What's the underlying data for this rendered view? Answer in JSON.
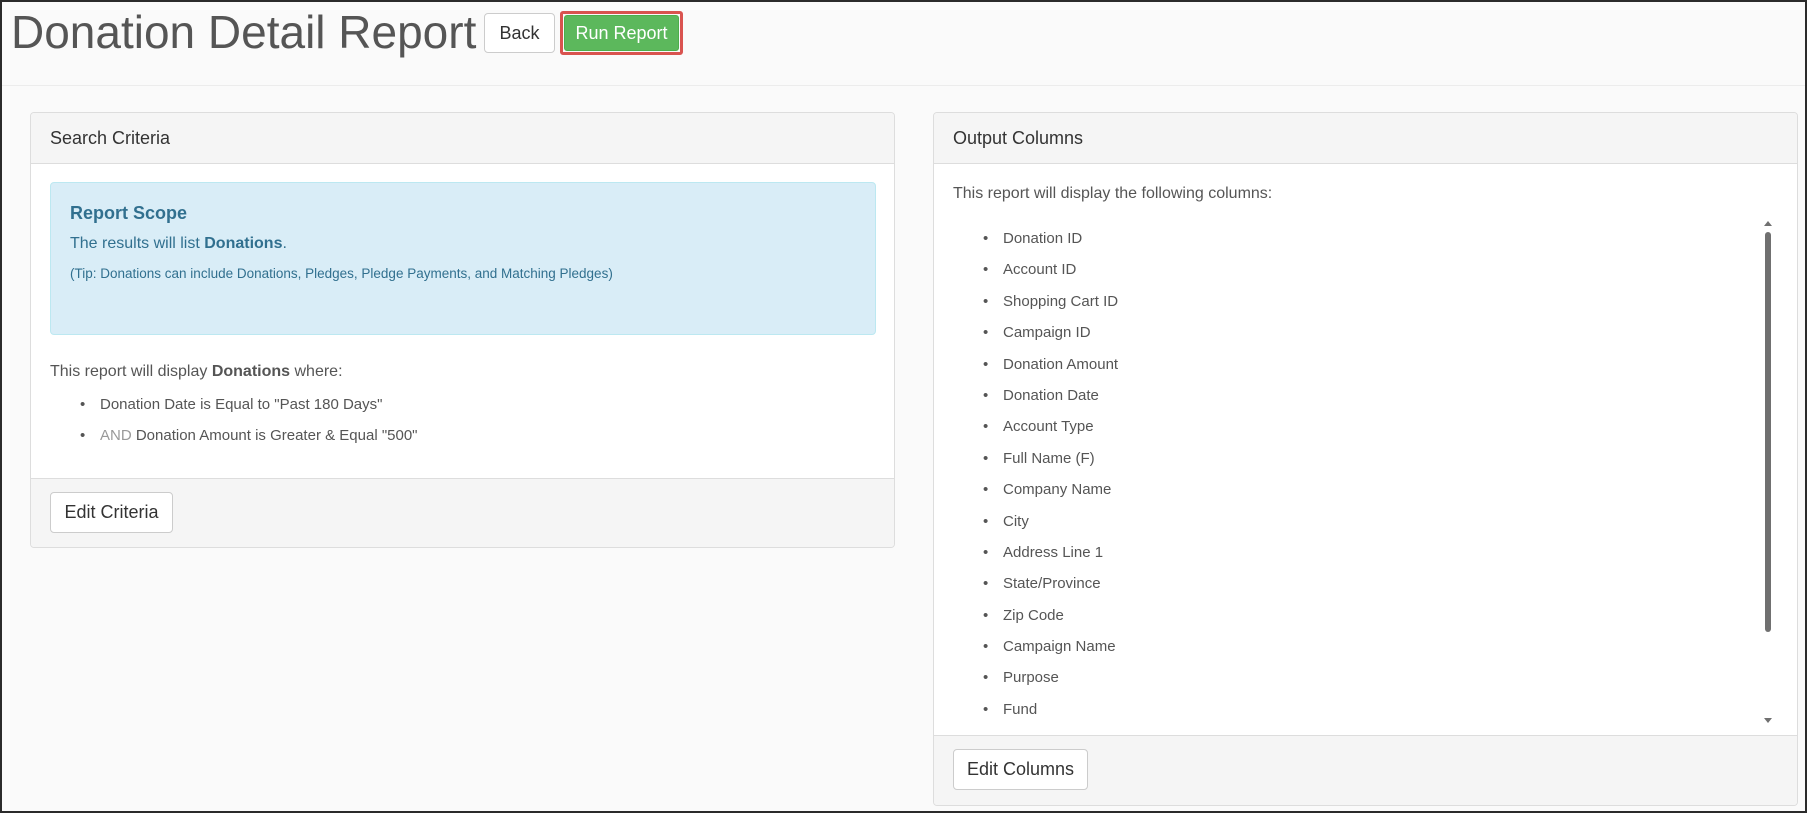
{
  "header": {
    "title": "Donation Detail Report",
    "back_label": "Back",
    "run_label": "Run Report"
  },
  "search_criteria": {
    "heading": "Search Criteria",
    "scope": {
      "title": "Report Scope",
      "text_prefix": "The results will list ",
      "text_entity": "Donations",
      "text_suffix": ".",
      "tip": "(Tip: Donations can include Donations, Pledges, Pledge Payments, and Matching Pledges)"
    },
    "intro_prefix": "This report will display ",
    "intro_entity": "Donations",
    "intro_suffix": " where:",
    "criteria": [
      {
        "prefix": "",
        "text": "Donation Date is Equal to \"Past 180 Days\""
      },
      {
        "prefix": "AND ",
        "text": "Donation Amount is Greater & Equal \"500\""
      }
    ],
    "edit_label": "Edit Criteria"
  },
  "output_columns": {
    "heading": "Output Columns",
    "intro": "This report will display the following columns:",
    "columns": [
      "Donation ID",
      "Account ID",
      "Shopping Cart ID",
      "Campaign ID",
      "Donation Amount",
      "Donation Date",
      "Account Type",
      "Full Name (F)",
      "Company Name",
      "City",
      "Address Line 1",
      "State/Province",
      "Zip Code",
      "Campaign Name",
      "Purpose",
      "Fund"
    ],
    "edit_label": "Edit Columns"
  },
  "colors": {
    "run_button": "#5cb85c",
    "run_highlight": "#d9534f",
    "scope_bg": "#d9edf7",
    "scope_text": "#31708f"
  }
}
